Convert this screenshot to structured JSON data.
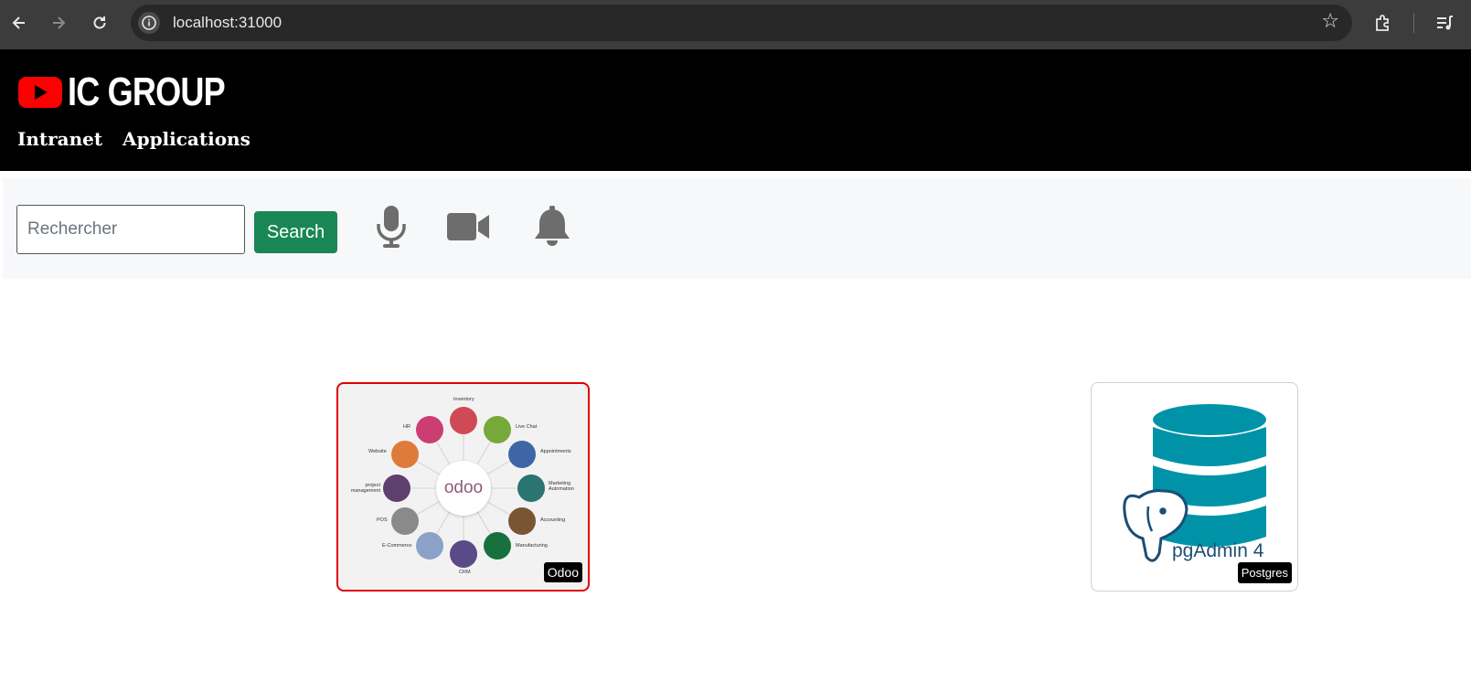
{
  "browser": {
    "url": "localhost:31000",
    "icons": [
      "back-arrow-icon",
      "forward-arrow-icon",
      "reload-icon",
      "site-info-icon",
      "bookmark-star-icon",
      "extensions-icon",
      "media-controls-icon"
    ]
  },
  "header": {
    "logo_text": "IC GROUP",
    "subtitle": "Intranet  Applications"
  },
  "toolbar": {
    "search_placeholder": "Rechercher",
    "search_value": "",
    "search_label": "Search",
    "icons": [
      "microphone-icon",
      "video-camera-icon",
      "bell-icon"
    ]
  },
  "apps": [
    {
      "name": "Odoo",
      "image": "odoo-modules-diagram",
      "modules": [
        "Inventory",
        "Live Chat",
        "Appointments",
        "Marketing Automation",
        "Accounting",
        "Manufacturing",
        "CRM",
        "E-Commerce",
        "POS",
        "project management",
        "Website",
        "HR"
      ],
      "center_label": "odoo"
    },
    {
      "name": "Postgres",
      "image": "pgadmin-database-logo",
      "image_text": "pgAdmin 4"
    }
  ],
  "colors": {
    "banner": "#000000",
    "search_button": "#198754",
    "selected_border": "#e00000",
    "logo_red": "#ff0000"
  }
}
